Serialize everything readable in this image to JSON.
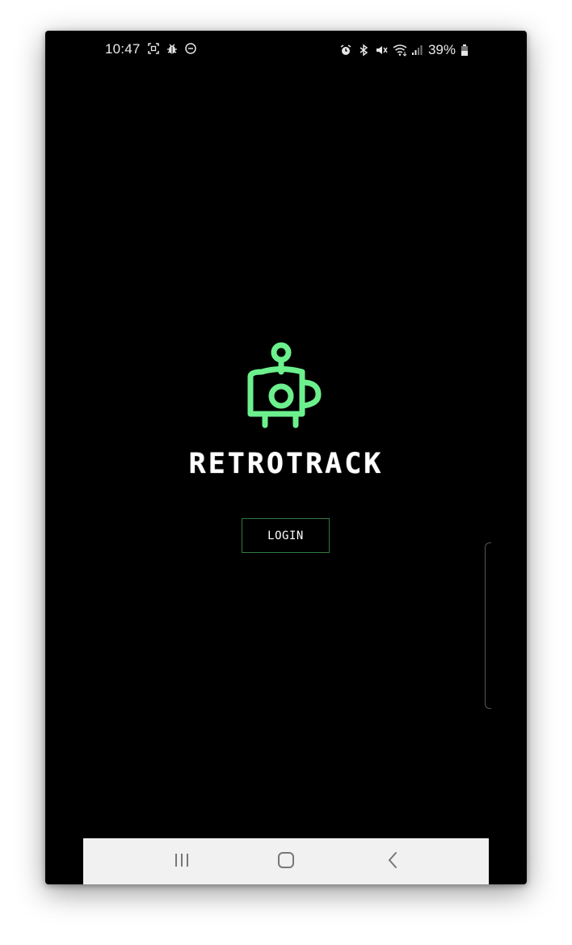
{
  "status_bar": {
    "time": "10:47",
    "battery_percent": "39%",
    "left_icons": [
      "screenshot-icon",
      "bug-icon",
      "do-not-disturb-icon"
    ],
    "right_icons": [
      "alarm-icon",
      "bluetooth-icon",
      "mute-icon",
      "wifi-icon",
      "signal-icon",
      "battery-icon"
    ]
  },
  "app": {
    "title": "RETROTRACK",
    "login_label": "LOGIN"
  },
  "nav_bar": {
    "buttons": [
      "recent-apps",
      "home",
      "back"
    ]
  },
  "colors": {
    "background": "#000000",
    "logo_green": "#6cf08e",
    "button_border": "#2f7a3e",
    "nav_bar": "#f1f1f1"
  }
}
